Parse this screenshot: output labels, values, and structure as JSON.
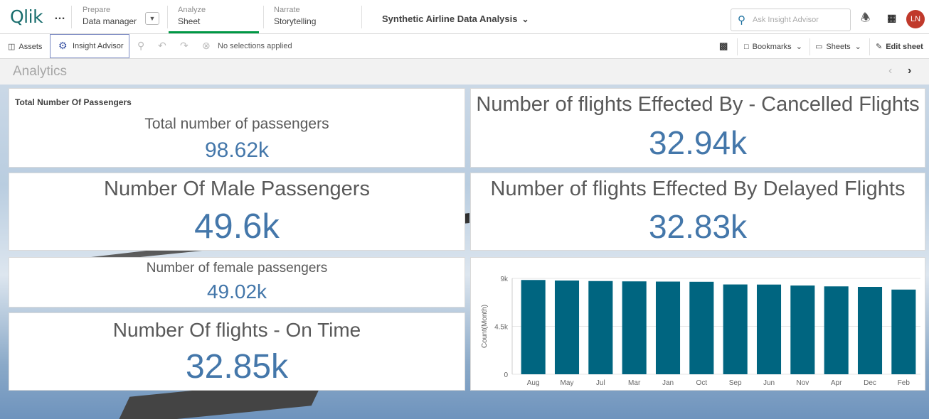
{
  "nav": {
    "logo": "Qlik",
    "more": "…",
    "prepare_label": "Prepare",
    "prepare_item": "Data manager",
    "analyze_label": "Analyze",
    "analyze_item": "Sheet",
    "narrate_label": "Narrate",
    "narrate_item": "Storytelling",
    "app_title": "Synthetic Airline Data Analysis",
    "search_placeholder": "Ask Insight Advisor",
    "avatar_initials": "LN"
  },
  "toolbar": {
    "assets": "Assets",
    "insight_advisor": "Insight Advisor",
    "no_selections": "No selections applied",
    "bookmarks": "Bookmarks",
    "sheets": "Sheets",
    "edit_sheet": "Edit sheet"
  },
  "sheet": {
    "title": "Analytics"
  },
  "kpis": {
    "total_passengers": {
      "card_title": "Total Number Of Passengers",
      "label": "Total number of passengers",
      "value": "98.62k"
    },
    "male": {
      "label": "Number Of Male Passengers",
      "value": "49.6k"
    },
    "female": {
      "label": "Number of female passengers",
      "value": "49.02k"
    },
    "on_time": {
      "label": "Number Of flights - On Time",
      "value": "32.85k"
    },
    "cancelled": {
      "label": "Number of flights Effected By - Cancelled Flights",
      "value": "32.94k"
    },
    "delayed": {
      "label": "Number of flights Effected By Delayed Flights",
      "value": "32.83k"
    }
  },
  "colors": {
    "bar": "#006580",
    "kpi_value": "#4477aa",
    "accent": "#009845",
    "avatar": "#c0392b"
  },
  "chart_data": {
    "type": "bar",
    "categories": [
      "Aug",
      "May",
      "Jul",
      "Mar",
      "Jan",
      "Oct",
      "Sep",
      "Jun",
      "Nov",
      "Apr",
      "Dec",
      "Feb"
    ],
    "values": [
      8850,
      8800,
      8750,
      8720,
      8700,
      8680,
      8430,
      8420,
      8330,
      8250,
      8200,
      7950
    ],
    "ylabel": "Count(Month)",
    "xlabel": "",
    "ylim": [
      0,
      9000
    ],
    "yticks": [
      {
        "v": 0,
        "label": "0"
      },
      {
        "v": 4500,
        "label": "4.5k"
      },
      {
        "v": 9000,
        "label": "9k"
      }
    ],
    "grid": true
  }
}
